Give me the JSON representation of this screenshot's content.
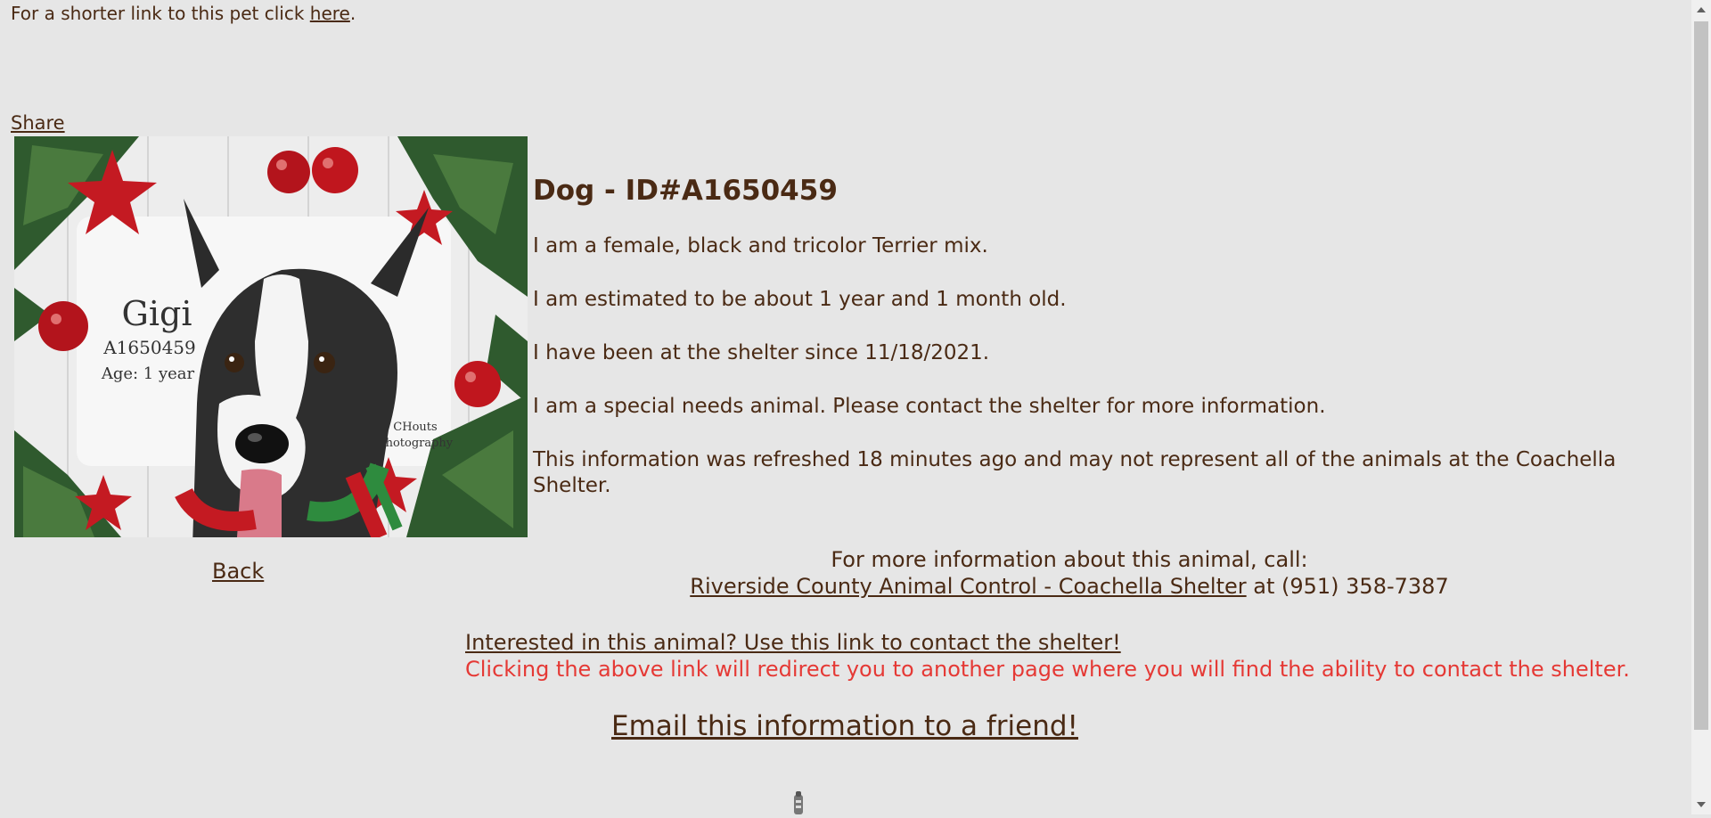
{
  "shortlink": {
    "prefix": "For a shorter link to this pet click ",
    "link": "here",
    "suffix": "."
  },
  "share_label": "Share",
  "photo": {
    "name": "Gigi",
    "id": "A1650459",
    "age": "Age: 1 year",
    "credit_line1": "CHouts",
    "credit_line2": "Photography"
  },
  "animal": {
    "title": "Dog - ID#A1650459",
    "description": "I am a female, black and tricolor Terrier mix.",
    "age": "I am estimated to be about 1 year and 1 month old.",
    "since": "I have been at the shelter since 11/18/2021.",
    "special_needs": "I am a special needs animal. Please contact the shelter for more information.",
    "refresh_note": "This information was refreshed 18 minutes ago and may not represent all of the animals at the Coachella Shelter."
  },
  "back_label": "Back",
  "contact": {
    "intro": "For more information about this animal, call:",
    "shelter_link": "Riverside County Animal Control - Coachella Shelter",
    "phone_text": " at (951) 358-7387"
  },
  "interest": {
    "link": "Interested in this animal? Use this link to contact the shelter!",
    "note": "Clicking the above link will redirect you to another page where you will find the ability to contact the shelter."
  },
  "email_label": "Email this information to a friend!",
  "colors": {
    "text": "#4a2a14",
    "note": "#e53935",
    "background": "#e6e6e6"
  }
}
